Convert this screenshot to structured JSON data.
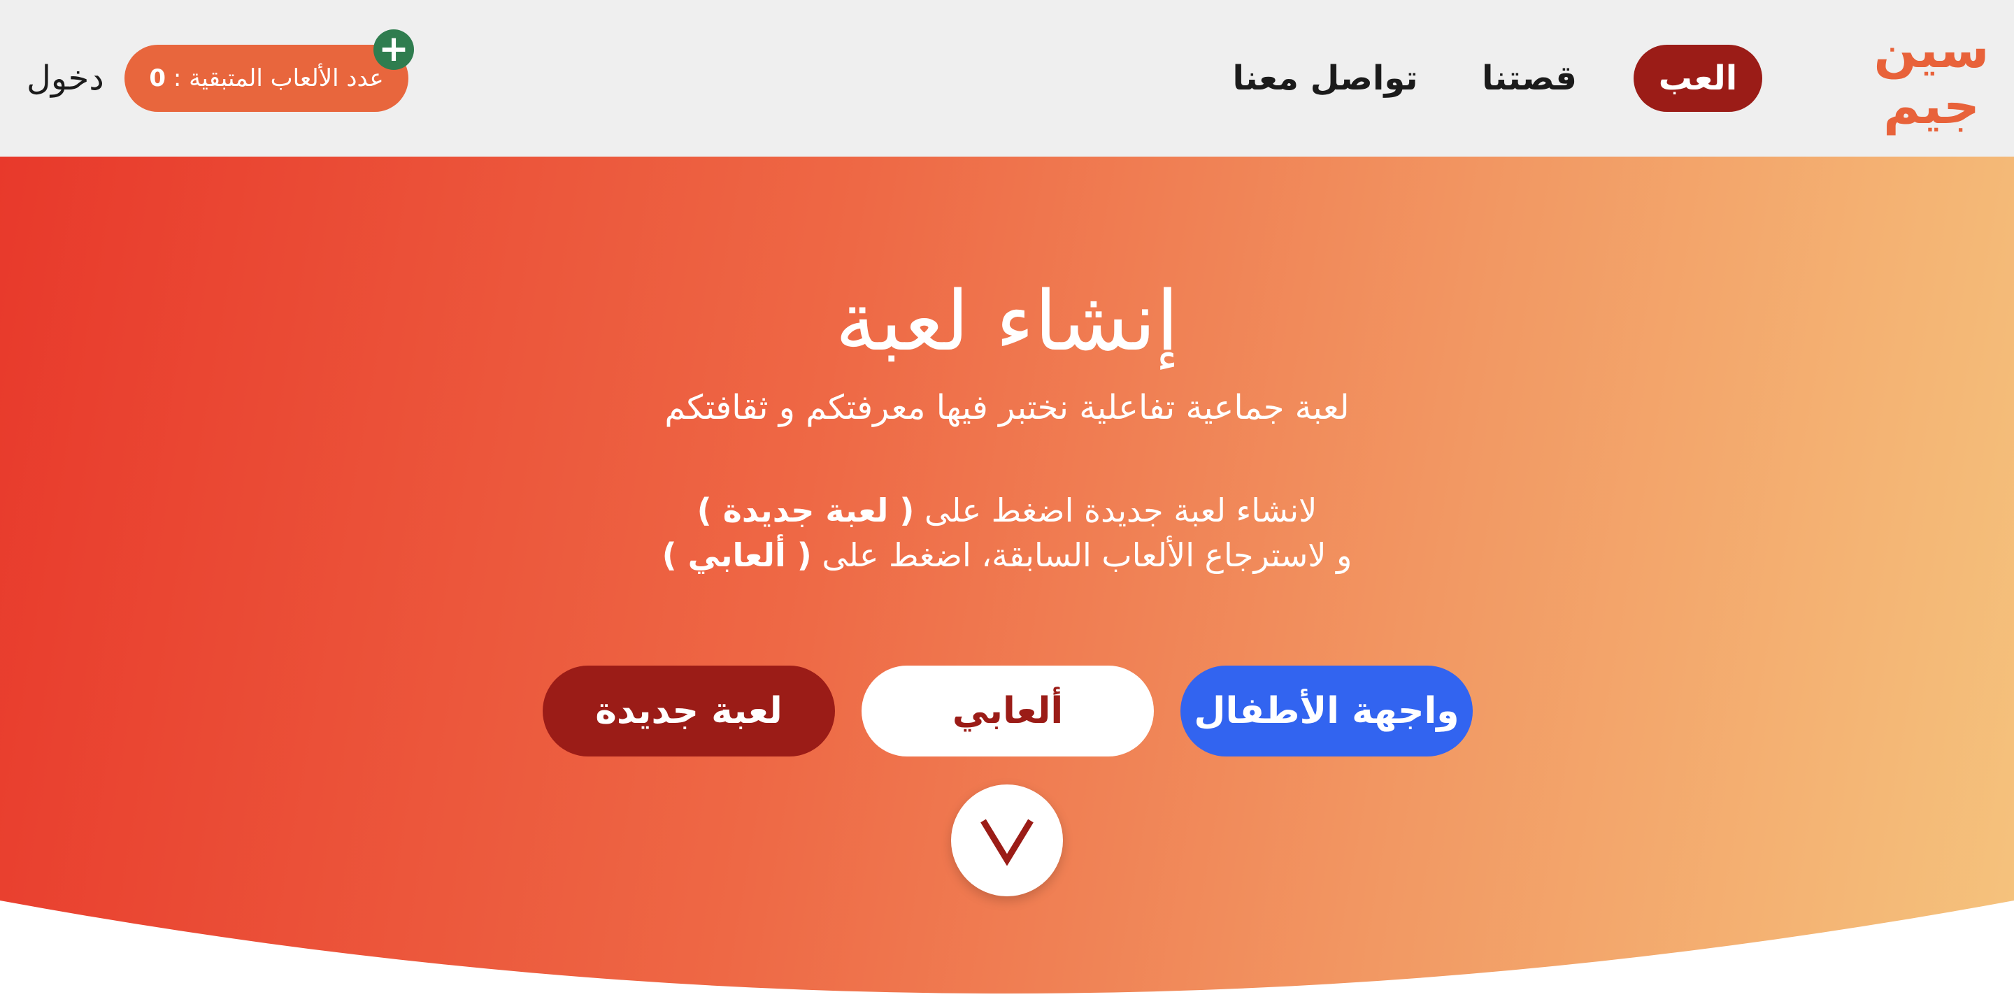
{
  "logo": {
    "line1": "سين",
    "line2": "جيم"
  },
  "nav": {
    "play": "العب",
    "story": "قصتنا",
    "contact": "تواصل معنا"
  },
  "account": {
    "remaining_games_label": "عدد الألعاب المتبقية :",
    "remaining_games_count": "0",
    "plus": "+",
    "login": "دخول"
  },
  "hero": {
    "title": "إنشاء لعبة",
    "subtitle": "لعبة جماعية تفاعلية نختبر فيها معرفتكم و ثقافتكم",
    "line1_prefix": "لانشاء لعبة جديدة اضغط على",
    "line1_bold": "( لعبة جديدة )",
    "line2_prefix": "و لاسترجاع الألعاب السابقة، اضغط على",
    "line2_bold": "( ألعابي )"
  },
  "buttons": {
    "new_game": "لعبة جديدة",
    "my_games": "ألعابي",
    "kids": "واجهة الأطفال"
  },
  "icons": {
    "scroll": "chevron-down-icon",
    "plus": "plus-icon"
  },
  "colors": {
    "brand_dark_red": "#9b1c17",
    "brand_orange": "#e8663d",
    "kids_blue": "#3264f0",
    "badge_green": "#2f7d4f"
  }
}
